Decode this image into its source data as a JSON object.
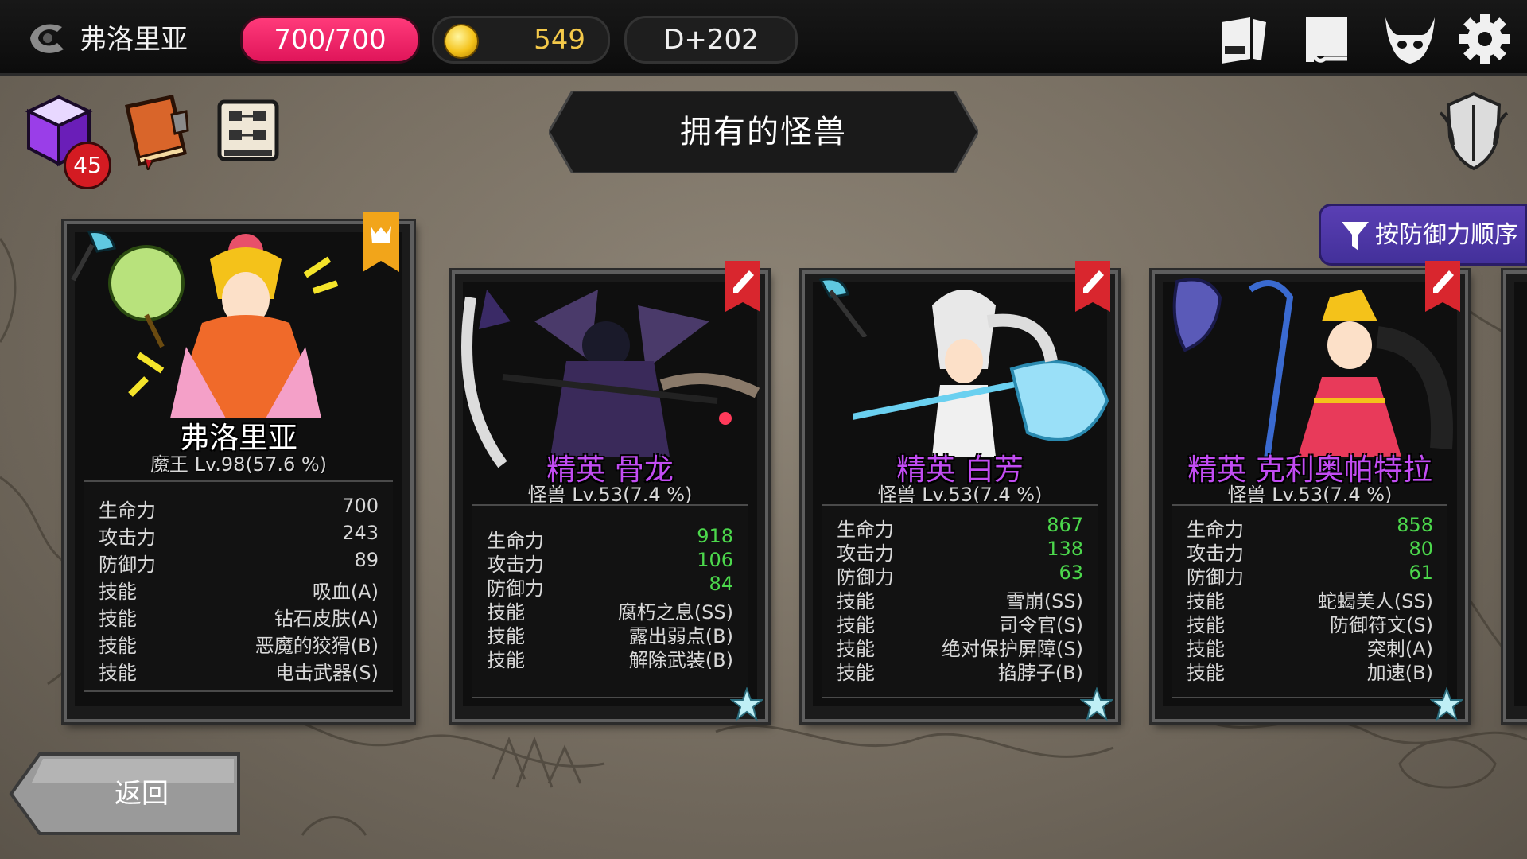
{
  "header": {
    "player_name": "弗洛里亚",
    "hp": "700/700",
    "gold": "549",
    "day": "D+202"
  },
  "quick": {
    "cube_badge": "45"
  },
  "title": "拥有的怪兽",
  "sort_label": "按防御力顺序",
  "back_label": "返回",
  "cards": [
    {
      "name": "弗洛里亚",
      "level": "魔王 Lv.98(57.6 %)",
      "stats": [
        {
          "label": "生命力",
          "value": "700"
        },
        {
          "label": "攻击力",
          "value": "243"
        },
        {
          "label": "防御力",
          "value": "89"
        },
        {
          "label": "技能",
          "value": "吸血(A)"
        },
        {
          "label": "技能",
          "value": "钻石皮肤(A)"
        },
        {
          "label": "技能",
          "value": "恶魔的狡猾(B)"
        },
        {
          "label": "技能",
          "value": "电击武器(S)"
        }
      ]
    },
    {
      "name": "精英 骨龙",
      "level": "怪兽 Lv.53(7.4 %)",
      "stats": [
        {
          "label": "生命力",
          "value": "918"
        },
        {
          "label": "攻击力",
          "value": "106"
        },
        {
          "label": "防御力",
          "value": "84"
        },
        {
          "label": "技能",
          "value": "腐朽之息(SS)"
        },
        {
          "label": "技能",
          "value": "露出弱点(B)"
        },
        {
          "label": "技能",
          "value": "解除武装(B)"
        }
      ]
    },
    {
      "name": "精英 白芳",
      "level": "怪兽 Lv.53(7.4 %)",
      "stats": [
        {
          "label": "生命力",
          "value": "867"
        },
        {
          "label": "攻击力",
          "value": "138"
        },
        {
          "label": "防御力",
          "value": "63"
        },
        {
          "label": "技能",
          "value": "雪崩(SS)"
        },
        {
          "label": "技能",
          "value": "司令官(S)"
        },
        {
          "label": "技能",
          "value": "绝对保护屏障(S)"
        },
        {
          "label": "技能",
          "value": "掐脖子(B)"
        }
      ]
    },
    {
      "name": "精英 克利奥帕特拉",
      "level": "怪兽 Lv.53(7.4 %)",
      "stats": [
        {
          "label": "生命力",
          "value": "858"
        },
        {
          "label": "攻击力",
          "value": "80"
        },
        {
          "label": "防御力",
          "value": "61"
        },
        {
          "label": "技能",
          "value": "蛇蝎美人(SS)"
        },
        {
          "label": "技能",
          "value": "防御符文(S)"
        },
        {
          "label": "技能",
          "value": "突刺(A)"
        },
        {
          "label": "技能",
          "value": "加速(B)"
        }
      ]
    }
  ],
  "colors": {
    "hp_pink": "#e0155a",
    "gold_text": "#f4c94a",
    "elite_purple": "#c24cf2",
    "stat_green": "#4cd84c",
    "sort_purple": "#4a35a6",
    "ribbon_red": "#d9262e",
    "leader_ribbon": "#f2a51a"
  }
}
